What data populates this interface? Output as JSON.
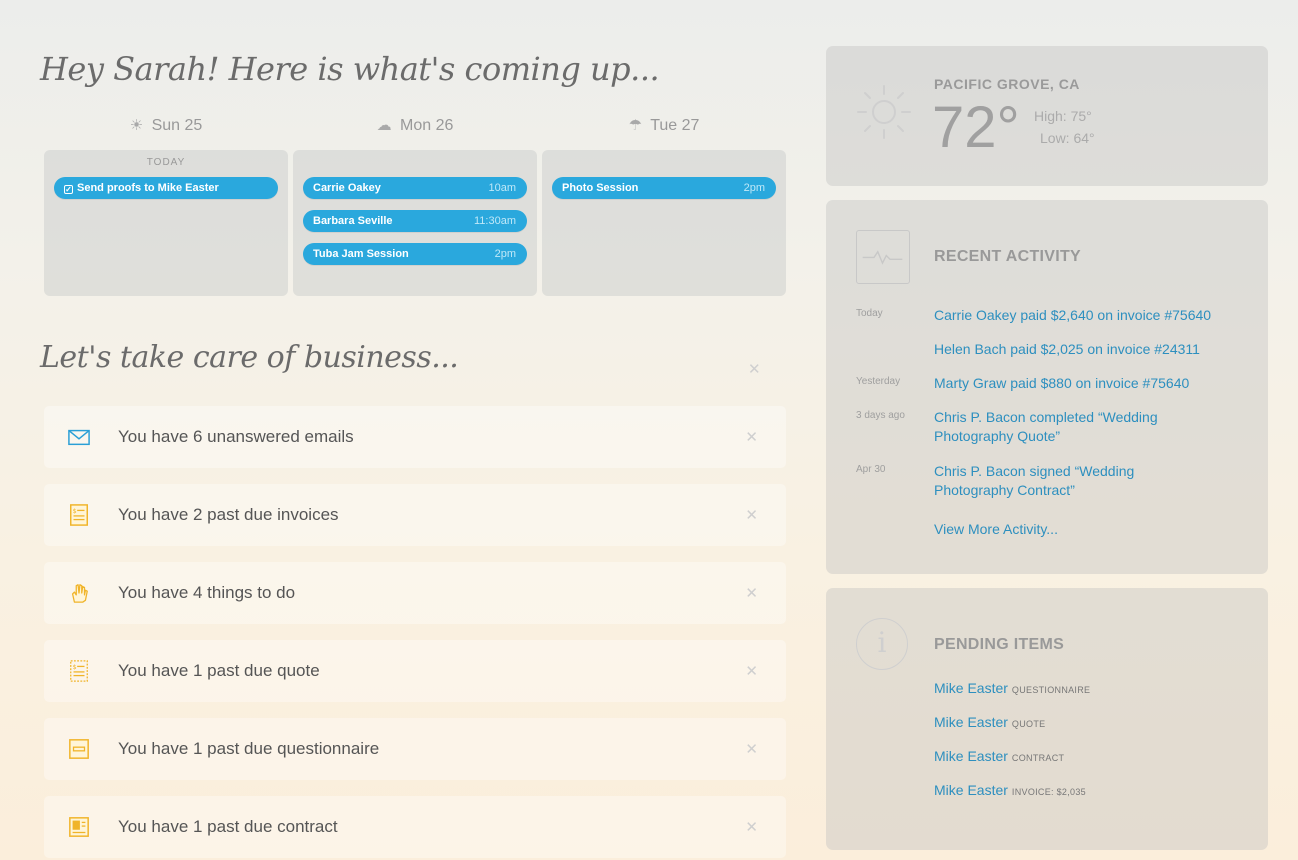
{
  "header": {
    "greeting": "Hey Sarah! Here is what's coming up..."
  },
  "calendar": {
    "days": [
      {
        "icon": "sun-icon",
        "label": "Sun 25",
        "tag": "TODAY",
        "events": [
          {
            "title": "Send proofs to Mike Easter",
            "time": "",
            "checkbox": true
          }
        ]
      },
      {
        "icon": "cloud-icon",
        "label": "Mon 26",
        "tag": "",
        "events": [
          {
            "title": "Carrie Oakey",
            "time": "10am"
          },
          {
            "title": "Barbara Seville",
            "time": "11:30am"
          },
          {
            "title": "Tuba Jam Session",
            "time": "2pm"
          }
        ]
      },
      {
        "icon": "rain-icon",
        "label": "Tue 27",
        "tag": "",
        "events": [
          {
            "title": "Photo Session",
            "time": "2pm"
          }
        ]
      }
    ],
    "event_color": "#2aa8dd"
  },
  "business": {
    "title": "Let's take care of business...",
    "tasks": [
      {
        "icon": "envelope-icon",
        "label": "You have 6 unanswered emails"
      },
      {
        "icon": "invoice-icon",
        "label": "You have 2 past due invoices"
      },
      {
        "icon": "hand-icon",
        "label": "You have 4 things to do"
      },
      {
        "icon": "quote-icon",
        "label": "You have 1 past due quote"
      },
      {
        "icon": "questionnaire-icon",
        "label": "You have 1 past due questionnaire"
      },
      {
        "icon": "contract-icon",
        "label": "You have 1 past due contract"
      }
    ],
    "accent_color": "#f0b429"
  },
  "weather": {
    "city": "PACIFIC GROVE, CA",
    "temp": "72°",
    "high": "High: 75°",
    "low": "Low: 64°",
    "icon": "sun-icon"
  },
  "activity": {
    "title": "RECENT ACTIVITY",
    "icon": "pulse-icon",
    "items": [
      {
        "date": "Today",
        "text": "Carrie Oakey paid $2,640 on invoice #75640"
      },
      {
        "date": "",
        "text": "Helen Bach paid $2,025 on invoice #24311"
      },
      {
        "date": "Yesterday",
        "text": "Marty Graw paid $880 on invoice #75640"
      },
      {
        "date": "3 days ago",
        "text": "Chris P. Bacon completed “Wedding Photography Quote”"
      },
      {
        "date": "Apr 30",
        "text": "Chris P. Bacon signed “Wedding Photography Contract”"
      }
    ],
    "more": "View More Activity...",
    "link_color": "#2d8fbf"
  },
  "pending": {
    "title": "PENDING ITEMS",
    "icon": "info-icon",
    "items": [
      {
        "name": "Mike Easter",
        "type": "QUESTIONNAIRE"
      },
      {
        "name": "Mike Easter",
        "type": "QUOTE"
      },
      {
        "name": "Mike Easter",
        "type": "CONTRACT"
      },
      {
        "name": "Mike Easter",
        "type": "INVOICE: $2,035"
      }
    ]
  }
}
